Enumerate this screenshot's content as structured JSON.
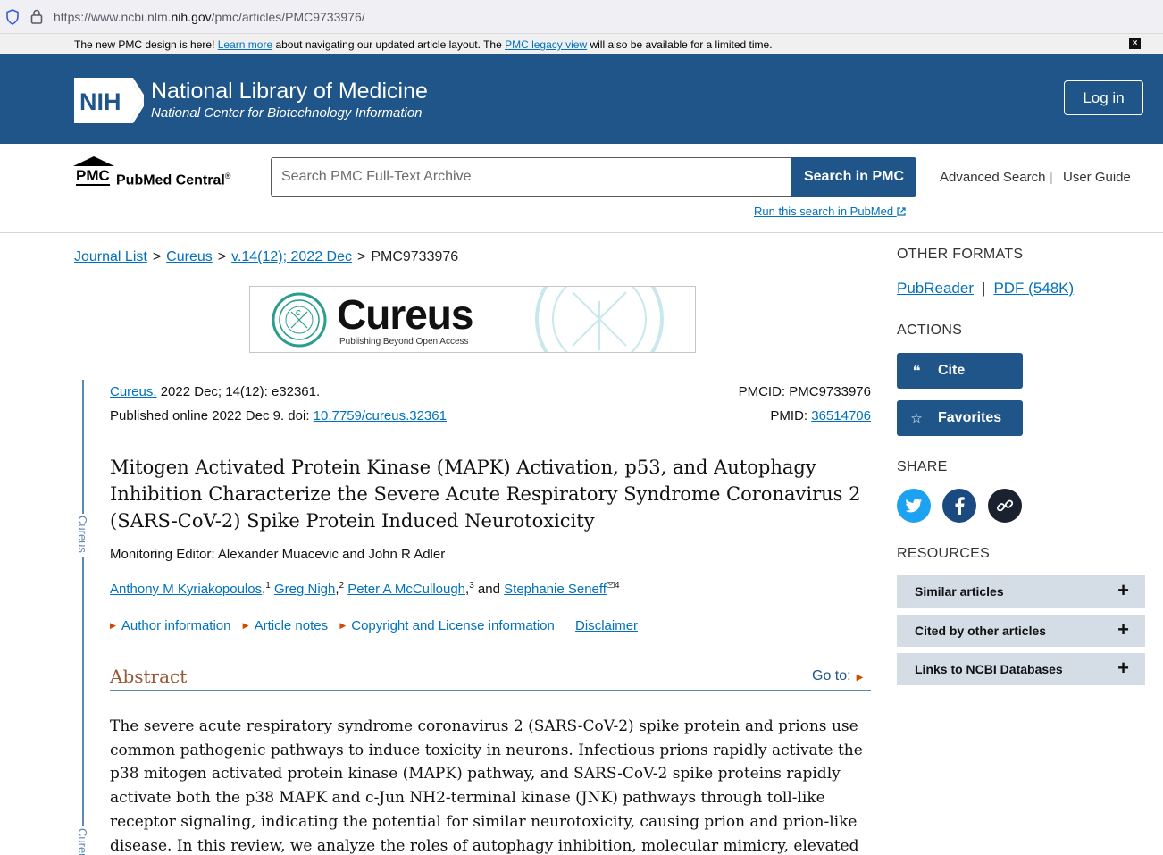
{
  "browser": {
    "url_prefix": "https://www.ncbi.nlm.",
    "url_domain": "nih.gov",
    "url_suffix": "/pmc/articles/PMC9733976/"
  },
  "notice": {
    "text1": "The new PMC design is here! ",
    "link1": "Learn more",
    "text2": " about navigating our updated article layout. The ",
    "link2": "PMC legacy view",
    "text3": " will also be available for a limited time.",
    "close": "×"
  },
  "header": {
    "nih_logo_text": "NIH",
    "title": "National Library of Medicine",
    "subtitle": "National Center for Biotechnology Information",
    "login_label": "Log in",
    "colors": {
      "brand": "#20558a"
    }
  },
  "search": {
    "logo_pmc": "PMC",
    "logo_name": "PubMed Central",
    "logo_reg": "®",
    "placeholder": "Search PMC Full-Text Archive",
    "button_label": "Search in PMC",
    "advanced": "Advanced Search",
    "separator": "|",
    "guide": "User Guide",
    "run_in_pubmed": "Run this search in PubMed"
  },
  "breadcrumb": {
    "items": [
      "Journal List",
      "Cureus",
      "v.14(12); 2022 Dec"
    ],
    "current": "PMC9733976",
    "sep": ">"
  },
  "journal_banner": {
    "name": "Cureus",
    "tagline": "Publishing Beyond Open Access",
    "side_label": "Cureus"
  },
  "article": {
    "journal_link": "Cureus.",
    "citation": " 2022 Dec; 14(12): e32361.",
    "published": "Published online 2022 Dec 9. doi: ",
    "doi": "10.7759/cureus.32361",
    "pmcid_label": "PMCID: PMC9733976",
    "pmid_label": "PMID: ",
    "pmid": "36514706",
    "title": "Mitogen Activated Protein Kinase (MAPK) Activation, p53, and Autophagy Inhibition Characterize the Severe Acute Respiratory Syndrome Coronavirus 2 (SARS-CoV-2) Spike Protein Induced Neurotoxicity",
    "editor": "Monitoring Editor: Alexander Muacevic and John R Adler",
    "authors": [
      {
        "name": "Anthony M Kyriakopoulos",
        "sup": "1"
      },
      {
        "name": "Greg Nigh",
        "sup": "2"
      },
      {
        "name": "Peter A McCullough",
        "sup": "3"
      },
      {
        "name": "Stephanie Seneff",
        "sup": "4"
      }
    ],
    "and": " and ",
    "info_links": [
      "Author information",
      "Article notes",
      "Copyright and License information"
    ],
    "disclaimer": "Disclaimer",
    "abstract_heading": "Abstract",
    "goto": "Go to:",
    "abstract_text": "The severe acute respiratory syndrome coronavirus 2 (SARS-CoV-2) spike protein and prions use common pathogenic pathways to induce toxicity in neurons. Infectious prions rapidly activate the p38 mitogen activated protein kinase (MAPK) pathway, and SARS-CoV-2 spike proteins rapidly activate both the p38 MAPK and c-Jun NH2-terminal kinase (JNK) pathways through toll-like receptor signaling, indicating the potential for similar neurotoxicity, causing prion and prion-like disease. In this review, we analyze the roles of autophagy inhibition, molecular mimicry, elevated"
  },
  "sidebar": {
    "other_formats": "OTHER FORMATS",
    "pubreader": "PubReader",
    "pdf": "PDF (548K)",
    "fmt_sep": "|",
    "actions": "ACTIONS",
    "cite": "Cite",
    "favorites": "Favorites",
    "share": "SHARE",
    "resources": "RESOURCES",
    "resource_items": [
      "Similar articles",
      "Cited by other articles",
      "Links to NCBI Databases"
    ],
    "plus": "+",
    "icons": [
      "twitter-icon",
      "facebook-icon",
      "link-icon"
    ]
  }
}
